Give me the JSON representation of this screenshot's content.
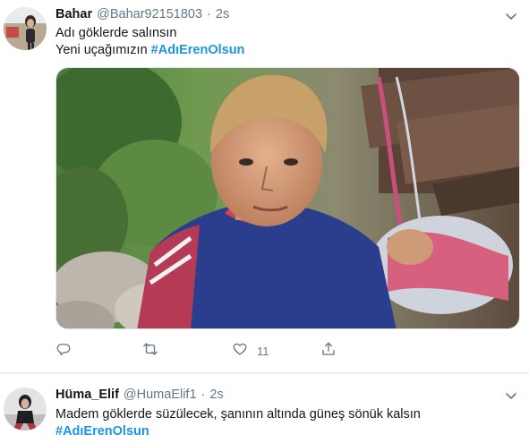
{
  "tweets": [
    {
      "name": "Bahar",
      "handle": "@Bahar92151803",
      "separator": "·",
      "time": "2s",
      "line1": "Adı göklerde salınsın",
      "line2_text": "Yeni uçağımızın ",
      "line2_hashtag": "#AdıErenOlsun",
      "media_icon": "photo",
      "actions": {
        "reply_icon": "reply-icon",
        "retweet_icon": "retweet-icon",
        "like_icon": "like-icon",
        "like_count": "11",
        "share_icon": "share-icon"
      }
    },
    {
      "name": "Hüma_Elif",
      "handle": "@HumaElif1",
      "separator": "·",
      "time": "2s",
      "line1": "Madem göklerde süzülecek, şanının altında güneş sönük  kalsın",
      "line2_hashtag": "#AdıErenOlsun"
    }
  ],
  "colors": {
    "text": "#14171a",
    "muted": "#657786",
    "hashtag": "#1b95e0",
    "divider": "#e6ecf0"
  }
}
